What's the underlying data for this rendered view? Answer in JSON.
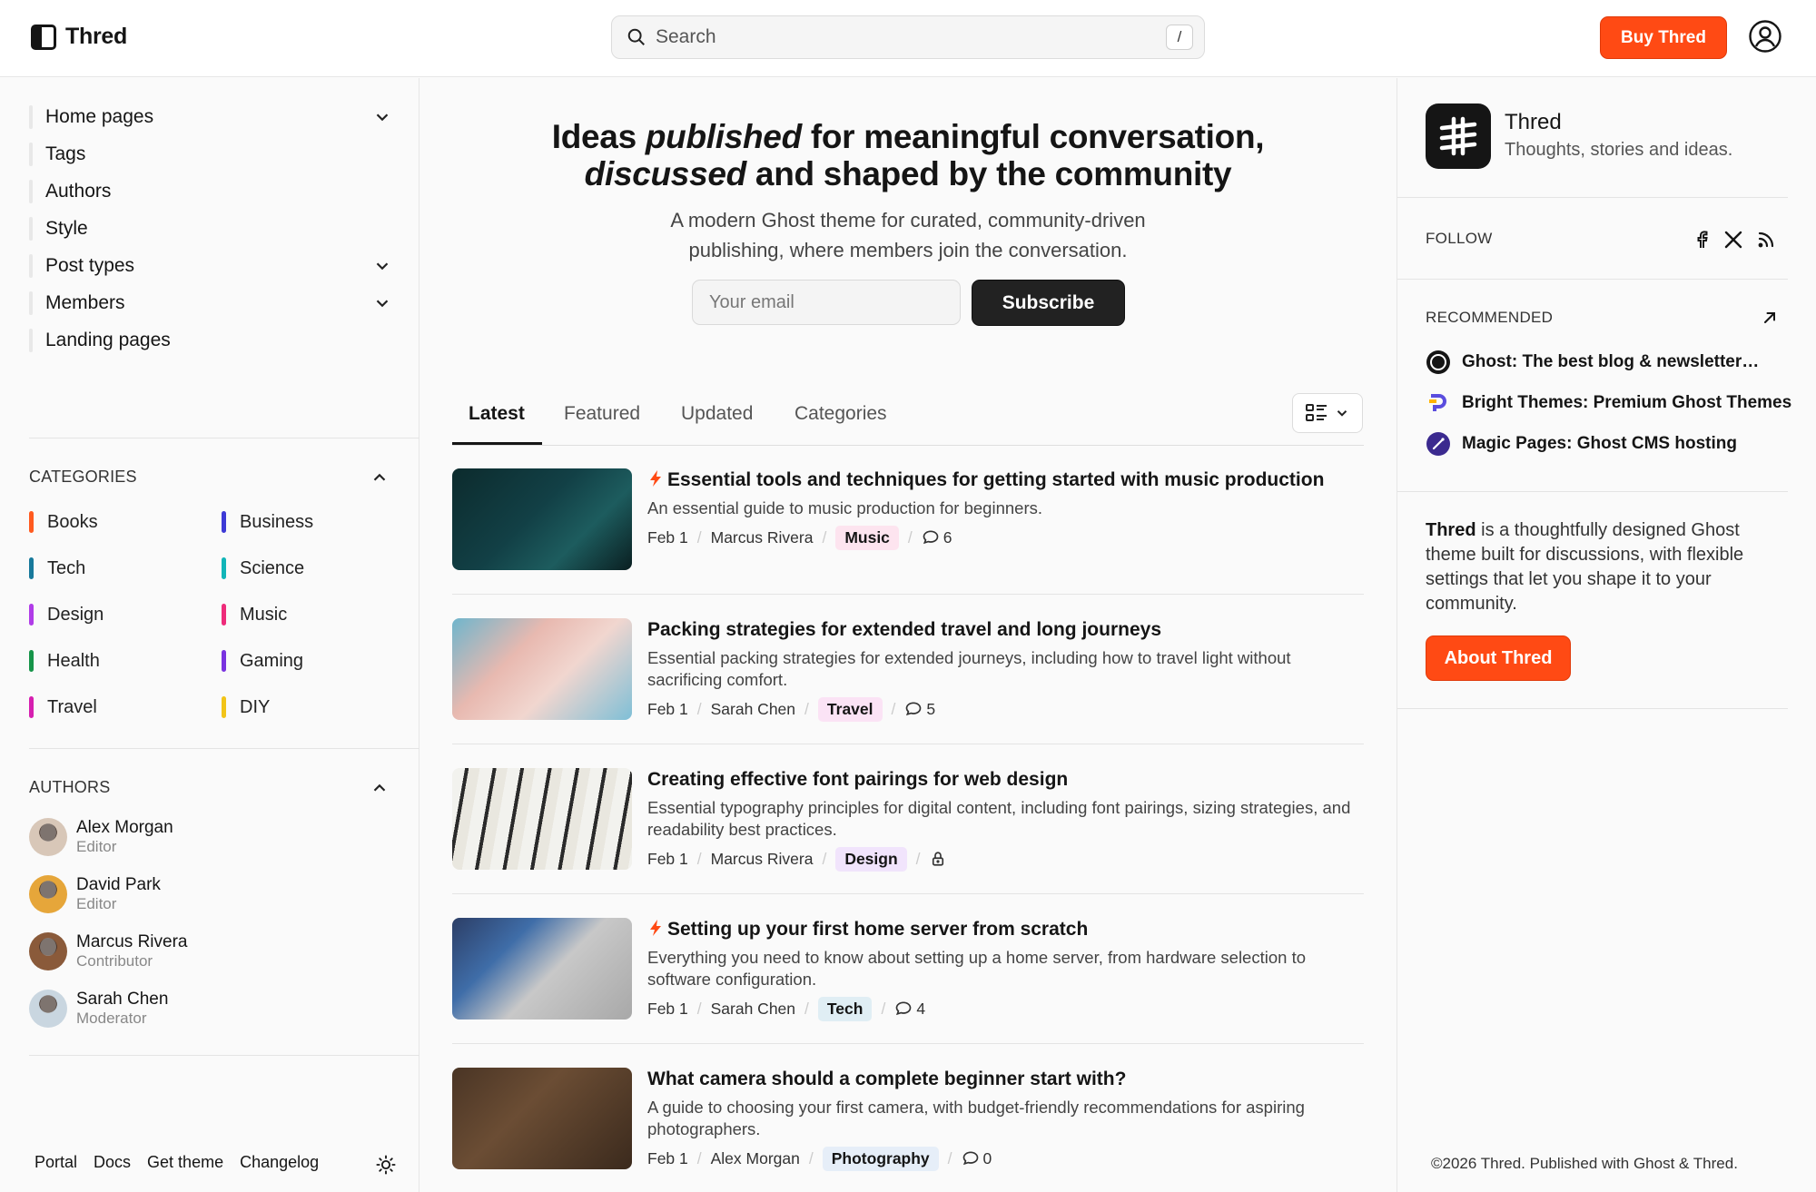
{
  "header": {
    "brand": "Thred",
    "search_placeholder": "Search",
    "search_shortcut": "/",
    "buy_button": "Buy Thred",
    "accent_color": "#ff4a14"
  },
  "sidebar": {
    "nav": [
      {
        "label": "Home pages",
        "expandable": true
      },
      {
        "label": "Tags",
        "expandable": false
      },
      {
        "label": "Authors",
        "expandable": false
      },
      {
        "label": "Style",
        "expandable": false
      },
      {
        "label": "Post types",
        "expandable": true
      },
      {
        "label": "Members",
        "expandable": true
      },
      {
        "label": "Landing pages",
        "expandable": false
      }
    ],
    "categories_title": "CATEGORIES",
    "categories": [
      {
        "label": "Books",
        "color": "#ff5a1f"
      },
      {
        "label": "Business",
        "color": "#3d3ad6"
      },
      {
        "label": "Tech",
        "color": "#17799b"
      },
      {
        "label": "Science",
        "color": "#11b5b8"
      },
      {
        "label": "Design",
        "color": "#b03ce8"
      },
      {
        "label": "Music",
        "color": "#ee2b7a"
      },
      {
        "label": "Health",
        "color": "#169449"
      },
      {
        "label": "Gaming",
        "color": "#7a33e0"
      },
      {
        "label": "Travel",
        "color": "#d61fb0"
      },
      {
        "label": "DIY",
        "color": "#f2c418"
      }
    ],
    "authors_title": "AUTHORS",
    "authors": [
      {
        "name": "Alex Morgan",
        "role": "Editor"
      },
      {
        "name": "David Park",
        "role": "Editor"
      },
      {
        "name": "Marcus Rivera",
        "role": "Contributor"
      },
      {
        "name": "Sarah Chen",
        "role": "Moderator"
      }
    ],
    "footer_links": [
      "Portal",
      "Docs",
      "Get theme",
      "Changelog"
    ],
    "theme_icon": "sun-icon"
  },
  "hero": {
    "title_1a": "Ideas ",
    "title_1b": "published",
    "title_1c": " for meaningful conversation,",
    "title_2a": "discussed",
    "title_2b": " and shaped by the community",
    "subtitle_1": "A modern Ghost theme for curated, community-driven",
    "subtitle_2": "publishing, where members join the conversation.",
    "email_placeholder": "Your email",
    "subscribe_button": "Subscribe"
  },
  "tabs": [
    "Latest",
    "Featured",
    "Updated",
    "Categories"
  ],
  "active_tab": "Latest",
  "posts": [
    {
      "featured": true,
      "title": "Essential tools and techniques for getting started with music production",
      "excerpt": "An essential guide to music production for beginners.",
      "date": "Feb 1",
      "author": "Marcus Rivera",
      "tag": "Music",
      "tag_bg": "#fde4ef",
      "comments": "6",
      "locked": false
    },
    {
      "featured": false,
      "title": "Packing strategies for extended travel and long journeys",
      "excerpt": "Essential packing strategies for extended journeys, including how to travel light without sacrificing comfort.",
      "date": "Feb 1",
      "author": "Sarah Chen",
      "tag": "Travel",
      "tag_bg": "#fbe3f5",
      "comments": "5",
      "locked": false
    },
    {
      "featured": false,
      "title": "Creating effective font pairings for web design",
      "excerpt": "Essential typography principles for digital content, including font pairings, sizing strategies, and readability best practices.",
      "date": "Feb 1",
      "author": "Marcus Rivera",
      "tag": "Design",
      "tag_bg": "#f1e4fc",
      "comments": "",
      "locked": true
    },
    {
      "featured": true,
      "title": "Setting up your first home server from scratch",
      "excerpt": "Everything you need to know about setting up a home server, from hardware selection to software configuration.",
      "date": "Feb 1",
      "author": "Sarah Chen",
      "tag": "Tech",
      "tag_bg": "#e0eef4",
      "comments": "4",
      "locked": false
    },
    {
      "featured": false,
      "title": "What camera should a complete beginner start with?",
      "excerpt": "A guide to choosing your first camera, with budget-friendly recommendations for aspiring photographers.",
      "date": "Feb 1",
      "author": "Alex Morgan",
      "tag": "Photography",
      "tag_bg": "#e6eef8",
      "comments": "0",
      "locked": false
    }
  ],
  "right": {
    "pub_name": "Thred",
    "pub_desc": "Thoughts, stories and ideas.",
    "follow_title": "FOLLOW",
    "social_icons": [
      "facebook-icon",
      "x-icon",
      "rss-icon"
    ],
    "recommended_title": "RECOMMENDED",
    "recommended": [
      {
        "label": "Ghost: The best blog & newsletter…",
        "icon": "ghost-icon"
      },
      {
        "label": "Bright Themes: Premium Ghost Themes",
        "icon": "bright-themes-icon"
      },
      {
        "label": "Magic Pages: Ghost CMS hosting",
        "icon": "magic-pages-icon"
      }
    ],
    "about_bold": "Thred",
    "about_text": " is a thoughtfully designed Ghost theme built for discussions, with flexible settings that let you shape it to your community.",
    "about_button": "About Thred",
    "copyright": "©2026 Thred. Published with Ghost & Thred."
  }
}
